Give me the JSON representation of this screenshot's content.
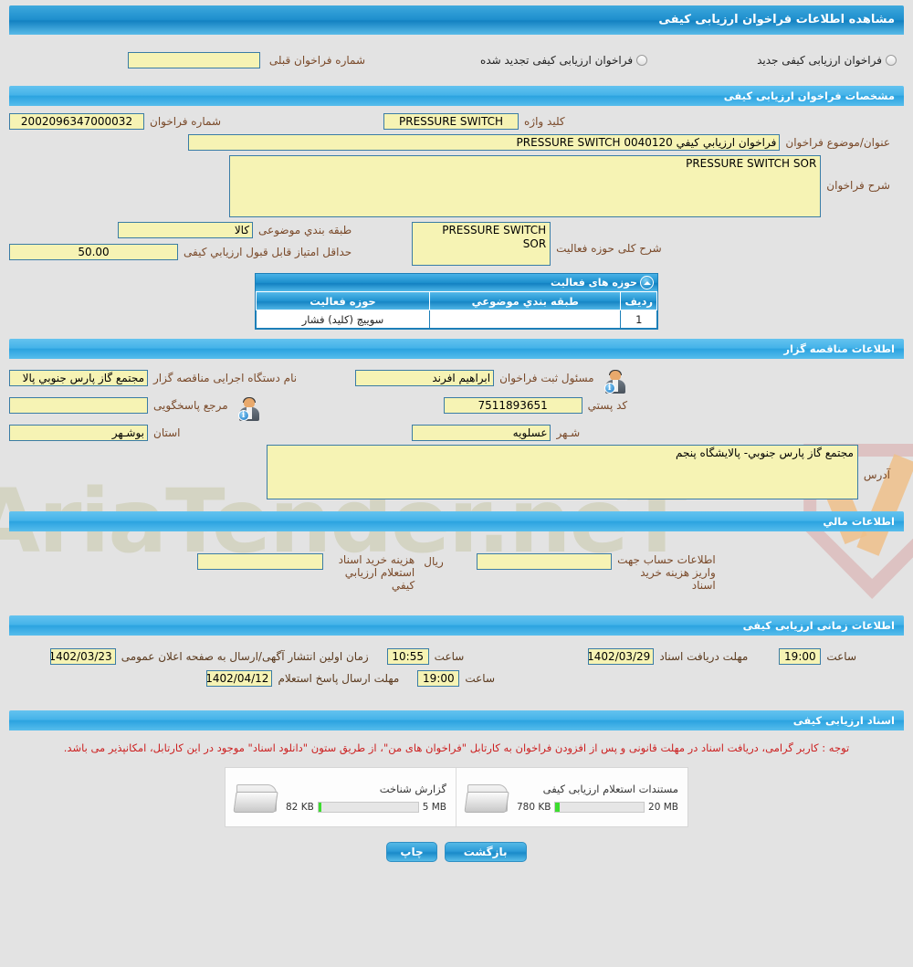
{
  "page": {
    "title": "مشاهده اطلاعات فراخوان ارزیابی کیفی"
  },
  "filter": {
    "new_option_label": "فراخوان ارزیابی کیفی جدید",
    "renewed_option_label": "فراخوان ارزیابی کیفی تجدید شده",
    "previous_number_label": "شماره فراخوان قبلی",
    "previous_number_value": ""
  },
  "specs": {
    "section_title": "مشخصات فراخوان ارزیابی کیفی",
    "tender_number_label": "شماره فراخوان",
    "tender_number_value": "2002096347000032",
    "keyword_label": "کلید واژه",
    "keyword_value": "PRESSURE SWITCH",
    "subject_label": "عنوان/موضوع فراخوان",
    "subject_value": "فراخوان ارزیابي کیفي 0040120 PRESSURE SWITCH",
    "description_label": "شرح فراخوان",
    "description_value": "PRESSURE SWITCH SOR",
    "category_label": "طبقه بندي موضوعی",
    "category_value": "كالا",
    "min_score_label": "حداقل امتیاز قابل قبول ارزیابي کیفی",
    "min_score_value": "50.00",
    "activity_summary_label": "شرح کلی حوزه فعالیت",
    "activity_summary_value": "PRESSURE SWITCH SOR"
  },
  "activity_domains": {
    "title": "حوزه های فعالیت",
    "columns": [
      "ردیف",
      "طبقه بندي موضوعي",
      "حوزه فعالیت"
    ],
    "rows": [
      {
        "index": "1",
        "category": "",
        "domain": "سوییچ (کلید) فشار"
      }
    ]
  },
  "organizer": {
    "section_title": "اطلاعات مناقصه گزار",
    "executive_org_label": "نام دستگاه اجرایی مناقصه گزار",
    "executive_org_value": "مجتمع گاز پارس جنوبي  پالا",
    "registrar_label": "مسئول ثبت فراخوان",
    "registrar_value": "ابراهیم افرند",
    "response_authority_label": "مرجع پاسخگویی",
    "response_authority_value": "",
    "postal_code_label": "کد پستي",
    "postal_code_value": "7511893651",
    "province_label": "استان",
    "province_value": "بوشـهر",
    "city_label": "شـهر",
    "city_value": "عسلویه",
    "address_label": "آدرس",
    "address_value": "مجتمع گاز پارس جنوبي- پالایشگاه پنجم"
  },
  "financial": {
    "section_title": "اطلاعات مالي",
    "docs_cost_label": "هزینه خرید اسناد استعلام ارزیابي کیفي",
    "docs_cost_value": "",
    "currency_label": "ریال",
    "account_info_label": "اطلاعات حساب جهت واریز هزینه خرید اسناد",
    "account_info_value": ""
  },
  "schedule": {
    "section_title": "اطلاعات زمانی ارزیابی کیفی",
    "publish_label": "زمان اولین انتشار آگهی/ارسال به صفحه اعلان عمومی",
    "publish_date": "1402/03/23",
    "publish_time_label": "ساعت",
    "publish_time": "10:55",
    "docs_deadline_label": "مهلت دریافت اسناد",
    "docs_deadline_date": "1402/03/29",
    "docs_deadline_time_label": "ساعت",
    "docs_deadline_time": "19:00",
    "response_deadline_label": "مهلت ارسال پاسخ استعلام",
    "response_deadline_date": "1402/04/12",
    "response_deadline_time_label": "ساعت",
    "response_deadline_time": "19:00"
  },
  "documents": {
    "section_title": "اسناد ارزیابی کیفی",
    "notice": "توجه : کاربر گرامی، دریافت اسناد در مهلت قانونی و پس از افزودن فراخوان به کارتابل \"فراخوان های من\"، از طریق ستون \"دانلود اسناد\" موجود در این کارتابل، امکانپذیر می باشد.",
    "files": [
      {
        "title": "گزارش شناخت",
        "used": "82 KB",
        "limit": "5 MB",
        "percent": 3
      },
      {
        "title": "مستندات استعلام ارزیابی کیفی",
        "used": "780 KB",
        "limit": "20 MB",
        "percent": 5
      }
    ]
  },
  "actions": {
    "print_label": "چاپ",
    "back_label": "بازگشت"
  },
  "watermark": {
    "text_a": "AriaTender",
    "text_b": ".neT"
  },
  "colors": {
    "header_blue": "#1e8fcd",
    "field_yellow": "#f6f3b4",
    "field_border": "#3a7ca5",
    "label_brown": "#7a4a2a",
    "notice_red": "#cc1f1f",
    "page_bg": "#e3e3e3",
    "progress_green": "#3ddd2f"
  }
}
